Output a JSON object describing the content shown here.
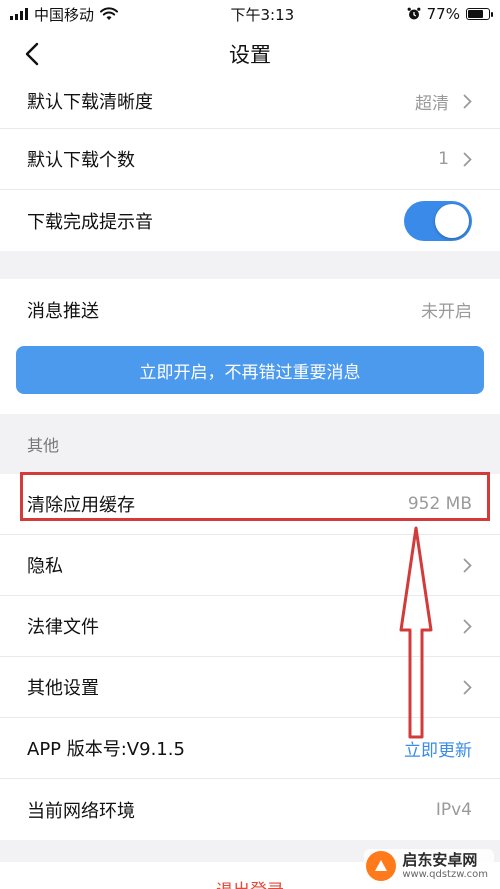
{
  "status_bar": {
    "carrier": "中国移动",
    "time": "下午3:13",
    "battery": "77%",
    "battery_level": 0.77
  },
  "nav": {
    "title": "设置"
  },
  "download_group": [
    {
      "label": "默认下载清晰度",
      "value": "超清"
    },
    {
      "label": "默认下载个数",
      "value": "1"
    },
    {
      "label": "下载完成提示音",
      "toggle": true
    }
  ],
  "push": {
    "label": "消息推送",
    "value": "未开启",
    "cta": "立即开启，不再错过重要消息"
  },
  "other": {
    "header": "其他",
    "cache": {
      "label": "清除应用缓存",
      "value": "952 MB"
    },
    "privacy": {
      "label": "隐私"
    },
    "legal": {
      "label": "法律文件"
    },
    "more": {
      "label": "其他设置"
    },
    "version": {
      "label": "APP 版本号:V9.1.5",
      "action": "立即更新"
    },
    "network": {
      "label": "当前网络环境",
      "value": "IPv4"
    }
  },
  "logout": "退出登录",
  "watermark": {
    "title": "启东安卓网",
    "url": "www.qdstzw.com"
  },
  "colors": {
    "accent": "#3a8be9",
    "cta": "#4b9aee",
    "highlight": "#d43a3a",
    "logout": "#e24a3c"
  }
}
